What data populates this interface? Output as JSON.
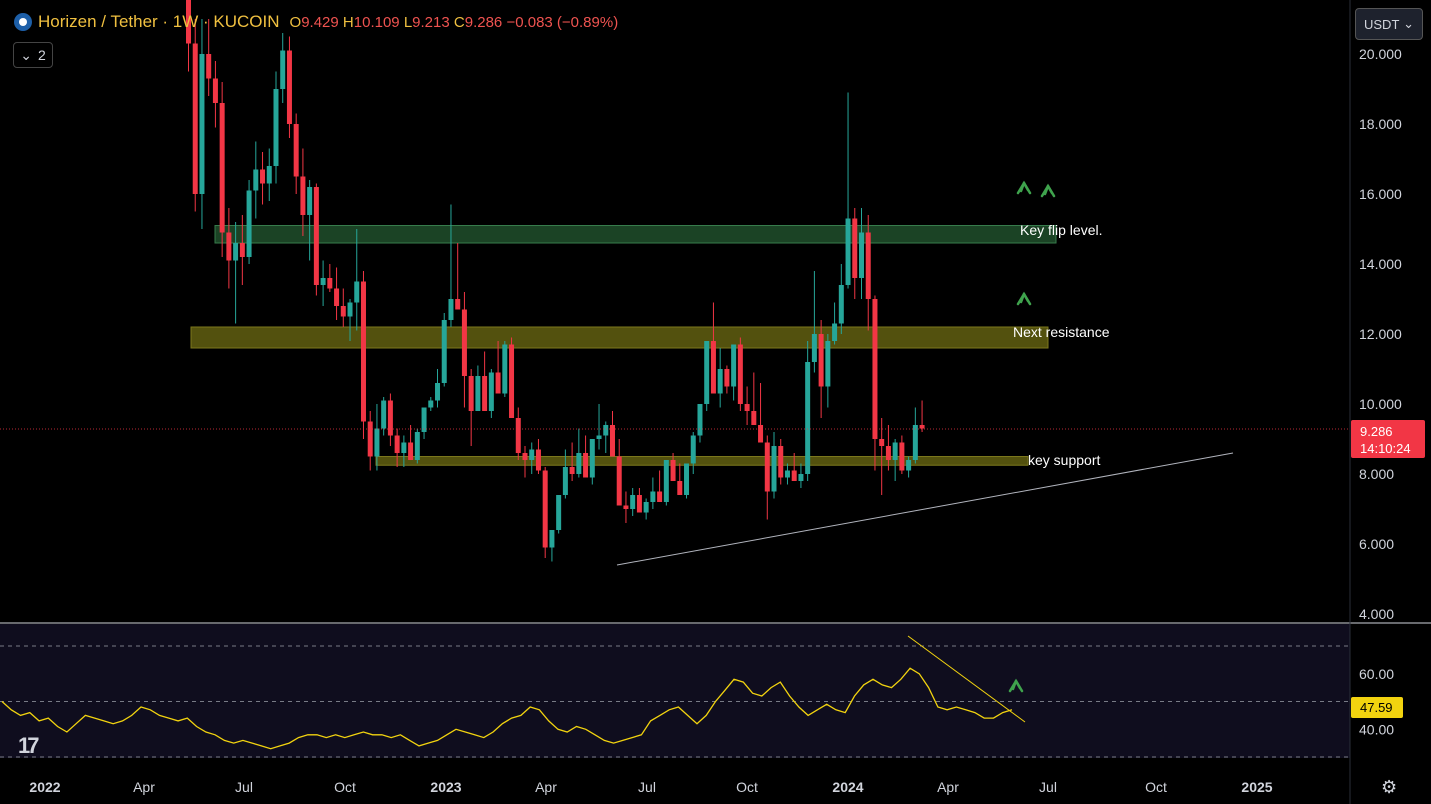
{
  "header": {
    "symbol": "Horizen / Tether · 1W · KUCOIN",
    "open_label": "O",
    "open": "9.429",
    "high_label": "H",
    "high": "10.109",
    "low_label": "L",
    "low": "9.213",
    "close_label": "C",
    "close": "9.286",
    "change": "−0.083 (−0.89%)",
    "collapse_count": "2",
    "currency": "USDT"
  },
  "colors": {
    "up": "#26a69a",
    "down": "#f23645",
    "rsi_line": "#f2d30f",
    "flip_zone": "#1f4b2a",
    "resistance_zone": "#5c5a10",
    "support_zone": "#5c5a10",
    "arrow": "#3fa34d"
  },
  "chart_data": [
    {
      "type": "candlestick",
      "title": "Horizen / Tether · 1W · KUCOIN",
      "y_ticks": [
        "20.000",
        "18.000",
        "16.000",
        "14.000",
        "12.000",
        "10.000",
        "8.000",
        "6.000",
        "4.000"
      ],
      "ylim": [
        4,
        20
      ],
      "x_ticks": [
        "2022",
        "Apr",
        "Jul",
        "Oct",
        "2023",
        "Apr",
        "Jul",
        "Oct",
        "2024",
        "Apr",
        "Jul",
        "Oct",
        "2025"
      ],
      "last_price": "9.286",
      "countdown": "14:10:24",
      "candles_ohlc": [
        [
          22.0,
          22.5,
          19.5,
          20.3
        ],
        [
          20.3,
          21.0,
          15.5,
          16.0
        ],
        [
          16.0,
          21.0,
          15.0,
          20.0
        ],
        [
          20.0,
          21.0,
          18.8,
          19.3
        ],
        [
          19.3,
          19.8,
          17.9,
          18.6
        ],
        [
          18.6,
          19.2,
          14.2,
          14.9
        ],
        [
          14.9,
          15.6,
          13.3,
          14.1
        ],
        [
          14.1,
          15.2,
          12.3,
          14.6
        ],
        [
          14.6,
          15.4,
          13.4,
          14.2
        ],
        [
          14.2,
          16.4,
          14.0,
          16.1
        ],
        [
          16.1,
          17.5,
          15.3,
          16.7
        ],
        [
          16.7,
          17.2,
          15.7,
          16.3
        ],
        [
          16.3,
          17.3,
          15.8,
          16.8
        ],
        [
          16.8,
          19.5,
          16.3,
          19.0
        ],
        [
          19.0,
          20.6,
          18.6,
          20.1
        ],
        [
          20.1,
          20.5,
          17.6,
          18.0
        ],
        [
          18.0,
          18.3,
          16.0,
          16.5
        ],
        [
          16.5,
          17.3,
          14.8,
          15.4
        ],
        [
          15.4,
          16.4,
          14.1,
          16.2
        ],
        [
          16.2,
          16.3,
          13.1,
          13.4
        ],
        [
          13.4,
          14.1,
          12.8,
          13.6
        ],
        [
          13.6,
          14.0,
          13.2,
          13.3
        ],
        [
          13.3,
          13.9,
          12.4,
          12.8
        ],
        [
          12.8,
          13.3,
          12.2,
          12.5
        ],
        [
          12.5,
          13.0,
          11.8,
          12.9
        ],
        [
          12.9,
          15.0,
          12.1,
          13.5
        ],
        [
          13.5,
          13.8,
          9.0,
          9.5
        ],
        [
          9.5,
          9.8,
          8.1,
          8.5
        ],
        [
          8.5,
          10.0,
          8.1,
          9.3
        ],
        [
          9.3,
          10.2,
          9.1,
          10.1
        ],
        [
          10.1,
          10.3,
          8.8,
          9.1
        ],
        [
          9.1,
          9.3,
          8.2,
          8.6
        ],
        [
          8.6,
          9.1,
          8.2,
          8.9
        ],
        [
          8.9,
          9.4,
          8.5,
          8.4
        ],
        [
          8.4,
          9.3,
          8.3,
          9.2
        ],
        [
          9.2,
          9.9,
          9.0,
          9.9
        ],
        [
          9.9,
          10.2,
          9.8,
          10.1
        ],
        [
          10.1,
          11.0,
          9.9,
          10.6
        ],
        [
          10.6,
          12.6,
          10.5,
          12.4
        ],
        [
          12.4,
          15.7,
          12.2,
          13.0
        ],
        [
          13.0,
          14.6,
          12.9,
          12.7
        ],
        [
          12.7,
          13.2,
          9.9,
          10.8
        ],
        [
          10.8,
          11.0,
          8.8,
          9.8
        ],
        [
          9.8,
          11.1,
          9.8,
          10.8
        ],
        [
          10.8,
          11.5,
          10.3,
          9.8
        ],
        [
          9.8,
          11.0,
          9.6,
          10.9
        ],
        [
          10.9,
          11.8,
          10.4,
          10.3
        ],
        [
          10.3,
          11.8,
          10.2,
          11.7
        ],
        [
          11.7,
          11.9,
          9.6,
          9.6
        ],
        [
          9.6,
          9.9,
          8.4,
          8.6
        ],
        [
          8.6,
          8.8,
          7.9,
          8.4
        ],
        [
          8.4,
          8.9,
          8.0,
          8.7
        ],
        [
          8.7,
          9.0,
          8.0,
          8.1
        ],
        [
          8.1,
          8.2,
          5.6,
          5.9
        ],
        [
          5.9,
          6.3,
          5.5,
          6.4
        ],
        [
          6.4,
          7.2,
          6.3,
          7.4
        ],
        [
          7.4,
          8.7,
          7.3,
          8.2
        ],
        [
          8.2,
          8.9,
          7.8,
          8.0
        ],
        [
          8.0,
          9.3,
          7.9,
          8.6
        ],
        [
          8.6,
          9.1,
          8.3,
          7.9
        ],
        [
          7.9,
          9.0,
          7.7,
          9.0
        ],
        [
          9.0,
          10.0,
          8.7,
          9.1
        ],
        [
          9.1,
          9.5,
          8.6,
          9.4
        ],
        [
          9.4,
          9.8,
          8.9,
          8.5
        ],
        [
          8.5,
          9.0,
          7.7,
          7.1
        ],
        [
          7.1,
          7.5,
          6.6,
          7.0
        ],
        [
          7.0,
          7.6,
          6.8,
          7.4
        ],
        [
          7.4,
          7.6,
          6.9,
          6.9
        ],
        [
          6.9,
          7.3,
          6.7,
          7.2
        ],
        [
          7.2,
          7.9,
          7.0,
          7.5
        ],
        [
          7.5,
          8.1,
          7.2,
          7.2
        ],
        [
          7.2,
          8.1,
          7.1,
          8.4
        ],
        [
          8.4,
          8.6,
          7.8,
          7.8
        ],
        [
          7.8,
          8.3,
          7.6,
          7.4
        ],
        [
          7.4,
          8.3,
          7.3,
          8.3
        ],
        [
          8.3,
          9.2,
          8.0,
          9.1
        ],
        [
          9.1,
          10.0,
          8.9,
          10.0
        ],
        [
          10.0,
          11.2,
          9.8,
          11.8
        ],
        [
          11.8,
          12.9,
          10.5,
          10.3
        ],
        [
          10.3,
          11.6,
          9.9,
          11.0
        ],
        [
          11.0,
          11.1,
          10.3,
          10.5
        ],
        [
          10.5,
          11.4,
          10.1,
          11.7
        ],
        [
          11.7,
          11.9,
          9.8,
          10.0
        ],
        [
          10.0,
          10.5,
          9.4,
          9.8
        ],
        [
          9.8,
          10.9,
          9.4,
          9.4
        ],
        [
          9.4,
          10.6,
          9.0,
          8.9
        ],
        [
          8.9,
          9.1,
          6.7,
          7.5
        ],
        [
          7.5,
          9.2,
          7.3,
          8.8
        ],
        [
          8.8,
          9.0,
          7.7,
          7.9
        ],
        [
          7.9,
          8.3,
          7.7,
          8.1
        ],
        [
          8.1,
          8.6,
          7.8,
          7.8
        ],
        [
          7.8,
          8.3,
          7.6,
          8.0
        ],
        [
          8.0,
          11.8,
          7.8,
          11.2
        ],
        [
          11.2,
          13.8,
          10.9,
          12.0
        ],
        [
          12.0,
          12.4,
          9.6,
          10.5
        ],
        [
          10.5,
          12.0,
          9.9,
          11.8
        ],
        [
          11.8,
          12.9,
          11.7,
          12.3
        ],
        [
          12.3,
          14.0,
          12.0,
          13.4
        ],
        [
          13.4,
          18.9,
          13.3,
          15.3
        ],
        [
          15.3,
          15.6,
          13.0,
          13.6
        ],
        [
          13.6,
          15.6,
          13.0,
          14.9
        ],
        [
          14.9,
          15.4,
          12.1,
          13.0
        ],
        [
          13.0,
          13.1,
          8.1,
          9.0
        ],
        [
          9.0,
          9.6,
          7.4,
          8.8
        ],
        [
          8.8,
          9.4,
          8.1,
          8.4
        ],
        [
          8.4,
          9.0,
          7.8,
          8.9
        ],
        [
          8.9,
          9.1,
          8.0,
          8.1
        ],
        [
          8.1,
          8.5,
          7.9,
          8.4
        ],
        [
          8.4,
          9.9,
          8.3,
          9.4
        ],
        [
          9.4,
          10.1,
          9.2,
          9.3
        ]
      ],
      "zones": [
        {
          "label": "Key flip level.",
          "top": 15.1,
          "bottom": 14.6
        },
        {
          "label": "Next resistance",
          "top": 12.2,
          "bottom": 11.6
        },
        {
          "label": "key support",
          "top": 8.5,
          "bottom": 8.25
        }
      ],
      "trendline": [
        [
          5.5,
          "Jun 2023"
        ],
        [
          8.6,
          "Sep 2024"
        ]
      ]
    },
    {
      "type": "line",
      "series": [
        {
          "values": [
            50,
            47,
            45,
            46,
            43,
            44,
            41,
            39,
            42,
            45,
            44,
            43,
            42,
            43,
            45,
            48,
            47,
            45,
            44,
            43,
            44,
            41,
            39,
            38,
            36,
            35,
            36,
            35,
            34,
            33,
            34,
            35,
            37,
            38,
            38,
            37,
            38,
            37,
            38,
            39,
            38,
            38,
            37,
            38,
            36,
            34,
            35,
            36,
            38,
            40,
            39,
            38,
            37,
            39,
            42,
            44,
            45,
            48,
            47,
            43,
            40,
            39,
            41,
            40,
            38,
            36,
            35,
            36,
            37,
            38,
            43,
            45,
            47,
            48,
            45,
            42,
            45,
            50,
            54,
            58,
            57,
            53,
            52,
            55,
            57,
            52,
            48,
            45,
            47,
            49,
            47,
            46,
            52,
            56,
            58,
            56,
            55,
            58,
            62,
            60,
            55,
            48,
            47,
            48,
            47,
            46,
            44,
            44,
            46,
            47
          ]
        }
      ],
      "y_ticks": [
        "60.00",
        "40.00"
      ],
      "ylim": [
        30,
        70
      ],
      "level_upper": 70,
      "level_mid": 50,
      "level_lower": 30,
      "current_value": "47.59"
    }
  ]
}
